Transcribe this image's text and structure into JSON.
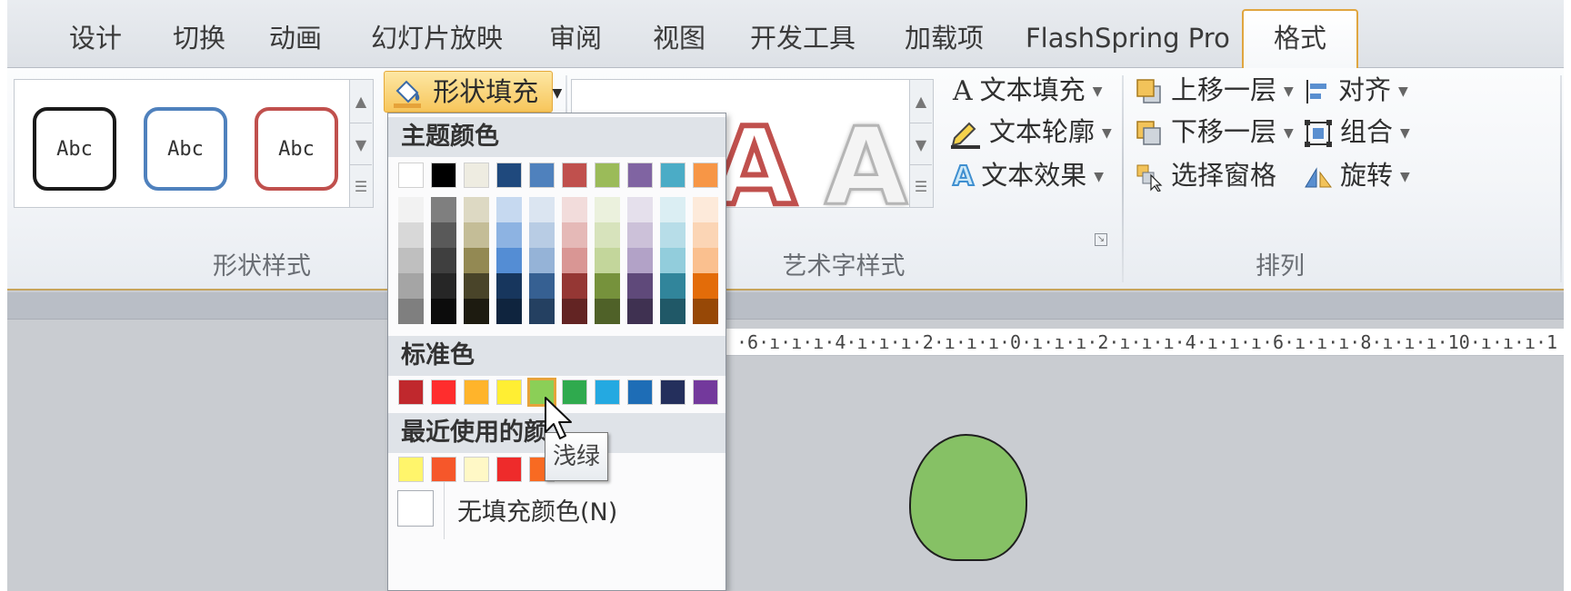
{
  "tabs": [
    {
      "label": "设计",
      "active": false
    },
    {
      "label": "切换",
      "active": false
    },
    {
      "label": "动画",
      "active": false
    },
    {
      "label": "幻灯片放映",
      "active": false
    },
    {
      "label": "审阅",
      "active": false
    },
    {
      "label": "视图",
      "active": false
    },
    {
      "label": "开发工具",
      "active": false
    },
    {
      "label": "加载项",
      "active": false
    },
    {
      "label": "FlashSpring Pro",
      "active": false
    },
    {
      "label": "格式",
      "active": true
    }
  ],
  "shape_styles": {
    "group_label": "形状样式",
    "items": [
      {
        "label": "Abc",
        "color": "#1a1a1a"
      },
      {
        "label": "Abc",
        "color": "#4f81bd"
      },
      {
        "label": "Abc",
        "color": "#c0504d"
      }
    ]
  },
  "shape_fill": {
    "label": "形状填充"
  },
  "wordart": {
    "group_label": "艺术字样式",
    "text_fill": "文本填充",
    "text_outline": "文本轮廓",
    "text_effects": "文本效果",
    "preview_glyph": "A"
  },
  "arrange": {
    "group_label": "排列",
    "bring_forward": "上移一层",
    "send_backward": "下移一层",
    "selection_pane": "选择窗格",
    "align": "对齐",
    "group": "组合",
    "rotate": "旋转"
  },
  "dropdown": {
    "theme_colors_header": "主题颜色",
    "theme_colors": [
      "#ffffff",
      "#000000",
      "#eeece1",
      "#1f497d",
      "#4f81bd",
      "#c0504d",
      "#9bbb59",
      "#8064a2",
      "#4bacc6",
      "#f79646"
    ],
    "theme_shades": [
      [
        "#f2f2f2",
        "#d8d8d8",
        "#bfbfbf",
        "#a5a5a5",
        "#7f7f7f"
      ],
      [
        "#7f7f7f",
        "#595959",
        "#3f3f3f",
        "#262626",
        "#0c0c0c"
      ],
      [
        "#ddd9c3",
        "#c4bd97",
        "#938953",
        "#494429",
        "#1d1b10"
      ],
      [
        "#c6d9f0",
        "#8db3e2",
        "#548dd4",
        "#17365d",
        "#0f243e"
      ],
      [
        "#dbe5f1",
        "#b8cce4",
        "#95b3d7",
        "#366092",
        "#244061"
      ],
      [
        "#f2dcdb",
        "#e5b9b7",
        "#d99694",
        "#953734",
        "#632423"
      ],
      [
        "#ebf1dd",
        "#d7e3bc",
        "#c3d69b",
        "#76923c",
        "#4f6128"
      ],
      [
        "#e5e0ec",
        "#ccc1d9",
        "#b2a2c7",
        "#5f497a",
        "#3f3151"
      ],
      [
        "#dbeef3",
        "#b7dde8",
        "#92cddc",
        "#31859b",
        "#205867"
      ],
      [
        "#fdeada",
        "#fbd5b5",
        "#fac08f",
        "#e36c09",
        "#974806"
      ]
    ],
    "standard_header": "标准色",
    "standard_colors": [
      "#c0282d",
      "#ff2d2d",
      "#ffb42b",
      "#ffee33",
      "#8bcf57",
      "#2faa4e",
      "#24a9e1",
      "#1e6db6",
      "#242f5c",
      "#73399c"
    ],
    "selected_standard_index": 4,
    "recent_header": "最近使用的颜",
    "recent_colors": [
      "#fff56b",
      "#f6572a",
      "#fff8c6",
      "#ee2b2b",
      "#f86a22"
    ],
    "no_fill": "无填充颜色(N)",
    "tooltip": "浅绿"
  },
  "ruler": {
    "text": "·6·ı·ı·ı·4·ı·ı·ı·2·ı·ı·ı·0·ı·ı·ı·2·ı·ı·ı·4·ı·ı·ı·6·ı·ı·ı·8·ı·ı·ı·10·ı·ı·ı·1"
  },
  "colors": {
    "accent_orange": "#e6a33a",
    "slide_shape_fill": "#86c165"
  }
}
